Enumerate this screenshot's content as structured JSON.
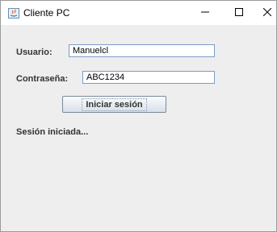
{
  "window": {
    "title": "Cliente PC",
    "icon": "java-icon",
    "controls": [
      "minimize-icon",
      "maximize-icon",
      "close-icon"
    ]
  },
  "form": {
    "user_label": "Usuario:",
    "user_value": "Manuelcl",
    "password_label": "Contraseña:",
    "password_value": "ABC1234",
    "login_button": "Iniciar sesión"
  },
  "status": {
    "text": "Sesión iniciada..."
  },
  "colors": {
    "window_bg": "#eeeeee",
    "titlebar_bg": "#ffffff",
    "field_border": "#7a9cc6"
  }
}
